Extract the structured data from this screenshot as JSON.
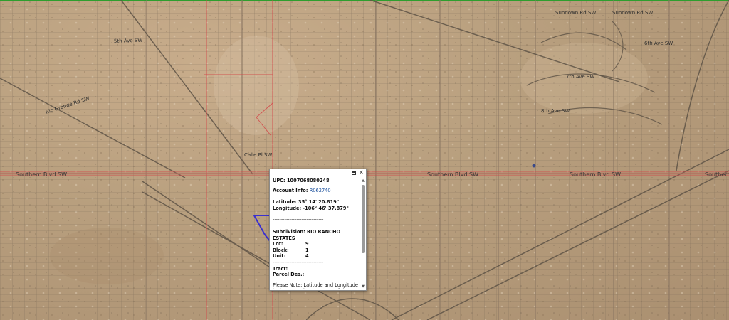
{
  "map": {
    "road_labels": [
      {
        "text": "5th Ave SW"
      },
      {
        "text": "Southern Blvd SW"
      },
      {
        "text": "Southern Blvd SW"
      },
      {
        "text": "Southern Blvd SW"
      },
      {
        "text": "Southern Blvd SW"
      },
      {
        "text": "Sundown Rd SW"
      },
      {
        "text": "6th Ave SW"
      },
      {
        "text": "7th Ave SW"
      },
      {
        "text": "8th Ave SW"
      },
      {
        "text": "Sundown Rd SW"
      },
      {
        "text": "Calle Pl SW"
      },
      {
        "text": "Rio Grande Rd SW"
      }
    ]
  },
  "popup": {
    "upc_label": "UPC:",
    "upc_value": "1007068080248",
    "account_label": "Account Info:",
    "account_link": "R062740",
    "latitude_label": "Latitude:",
    "latitude_value": "35° 14' 20.819\"",
    "longitude_label": "Longitude:",
    "longitude_value": "-106° 46' 37.879\"",
    "separator": "------------------------------",
    "subdivision_label": "Subdivision:",
    "subdivision_value": "RIO RANCHO ESTATES",
    "lot_label": "Lot:",
    "lot_value": "9",
    "block_label": "Block:",
    "block_value": "1",
    "unit_label": "Unit:",
    "unit_value": "4",
    "separator2": "------------------------------",
    "tract_label": "Tract:",
    "parcel_label": "Parcel Des.:",
    "note": "Please Note: Latitude and Longitude is the approximate center of the parcel shown.",
    "maximize_icon": "maximize-icon",
    "close_icon": "close-icon",
    "close_glyph": "✕"
  },
  "colors": {
    "road_main": "#b86a5c",
    "parcel_red": "#d24a4a",
    "selection_blue": "#3a2fd0",
    "link": "#1a4f9c",
    "frame_green": "#2e9e2e"
  }
}
